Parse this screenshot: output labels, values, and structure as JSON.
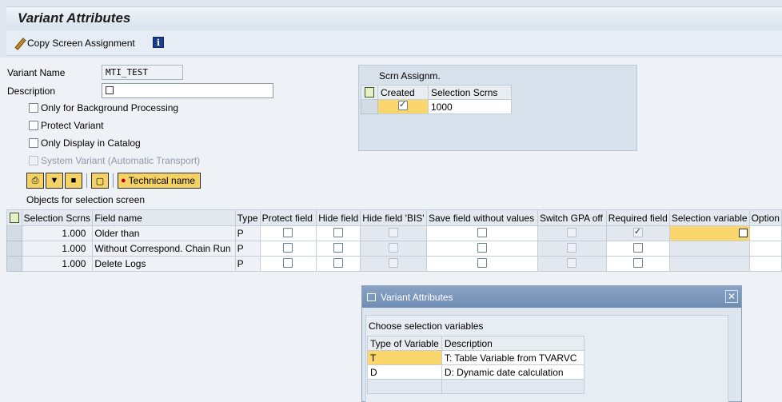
{
  "title": "Variant Attributes",
  "toolbar": {
    "copy_label": "Copy Screen Assignment"
  },
  "form": {
    "variant_name_label": "Variant Name",
    "variant_name_value": "MTI_TEST",
    "description_label": "Description",
    "checkboxes": [
      "Only for Background Processing",
      "Protect Variant",
      "Only Display in Catalog",
      "System Variant (Automatic Transport)"
    ]
  },
  "scrn": {
    "header": "Scrn Assignm.",
    "col_created": "Created",
    "col_selection": "Selection Scrns",
    "value": "1000"
  },
  "buttons": {
    "technical_name": "Technical name"
  },
  "objects": {
    "header": "Objects for selection screen",
    "columns": [
      "Selection Scrns",
      "Field name",
      "Type",
      "Protect field",
      "Hide field",
      "Hide field 'BIS'",
      "Save field without values",
      "Switch GPA off",
      "Required field",
      "Selection variable",
      "Option"
    ],
    "rows": [
      {
        "scrns": "1.000",
        "field": "Older than",
        "type": "P"
      },
      {
        "scrns": "1.000",
        "field": "Without Correspond. Chain Run",
        "type": "P"
      },
      {
        "scrns": "1.000",
        "field": "Delete Logs",
        "type": "P"
      }
    ]
  },
  "dialog": {
    "title": "Variant Attributes",
    "header": "Choose selection variables",
    "col_type": "Type of Variable",
    "col_desc": "Description",
    "rows": [
      {
        "type": "T",
        "desc": "T: Table Variable from TVARVC"
      },
      {
        "type": "D",
        "desc": "D: Dynamic date calculation"
      }
    ]
  }
}
